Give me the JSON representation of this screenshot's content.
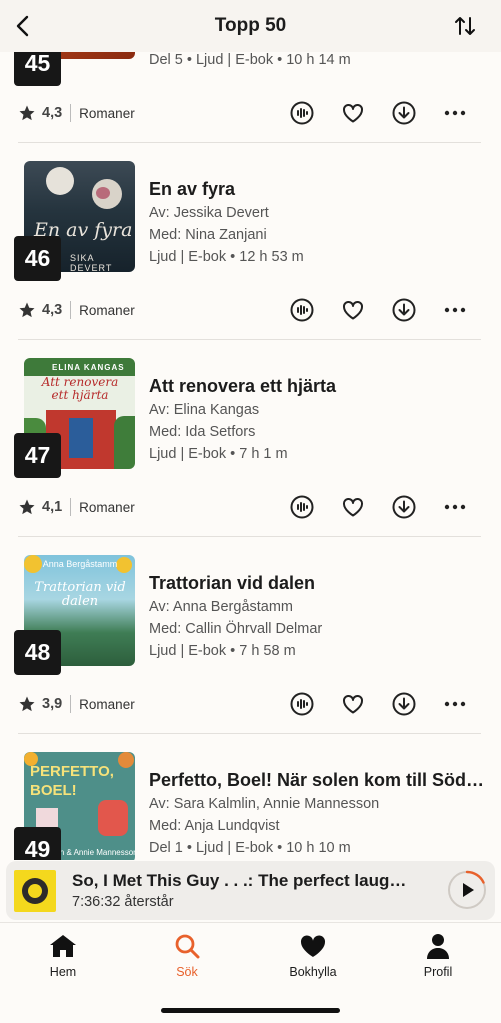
{
  "header": {
    "title": "Topp 50"
  },
  "items": [
    {
      "rank": "45",
      "title": "",
      "line1": "Del 5 • Ljud | E-bok • 10 h 14 m",
      "line2": "",
      "line3": "",
      "rating": "4,3",
      "genre": "Romaner"
    },
    {
      "rank": "46",
      "title": "En av fyra",
      "line1": "Av: Jessika Devert",
      "line2": "Med: Nina Zanjani",
      "line3": "Ljud | E-bok • 12 h 53 m",
      "rating": "4,3",
      "genre": "Romaner",
      "cover_text": "En av fyra",
      "cover_author": "SIKA DEVERT"
    },
    {
      "rank": "47",
      "title": "Att renovera ett hjärta",
      "line1": "Av: Elina Kangas",
      "line2": "Med: Ida Setfors",
      "line3": "Ljud | E-bok • 7 h 1 m",
      "rating": "4,1",
      "genre": "Romaner",
      "cover_text": "Att renovera ett hjärta",
      "cover_author": "ELINA KANGAS"
    },
    {
      "rank": "48",
      "title": "Trattorian vid dalen",
      "line1": "Av: Anna Bergåstamm",
      "line2": "Med: Callin Öhrvall Delmar",
      "line3": "Ljud | E-bok • 7 h 58 m",
      "rating": "3,9",
      "genre": "Romaner",
      "cover_text": "Trattorian vid dalen",
      "cover_author": "Anna Bergåstamm"
    },
    {
      "rank": "49",
      "title": "Perfetto, Boel! När solen kom till Söd…",
      "line1": "Av: Sara Kalmlin, Annie Mannesson",
      "line2": "Med: Anja Lundqvist",
      "line3": "Del 1 • Ljud | E-bok • 10 h 10 m",
      "cover_text": "PERFETTO, BOEL!",
      "cover_author": "Kalmlin & Annie Mannesson"
    }
  ],
  "player": {
    "title": "So, I Met This Guy . . .: The perfect laug…",
    "time_left": "7:36:32 återstår"
  },
  "tabs": [
    {
      "label": "Hem",
      "icon": "home-icon"
    },
    {
      "label": "Sök",
      "icon": "search-icon",
      "active": true
    },
    {
      "label": "Bokhylla",
      "icon": "heart-icon"
    },
    {
      "label": "Profil",
      "icon": "profile-icon"
    }
  ],
  "colors": {
    "accent": "#e8612c",
    "rank_badge": "#171717",
    "background": "#fdfbf8"
  }
}
